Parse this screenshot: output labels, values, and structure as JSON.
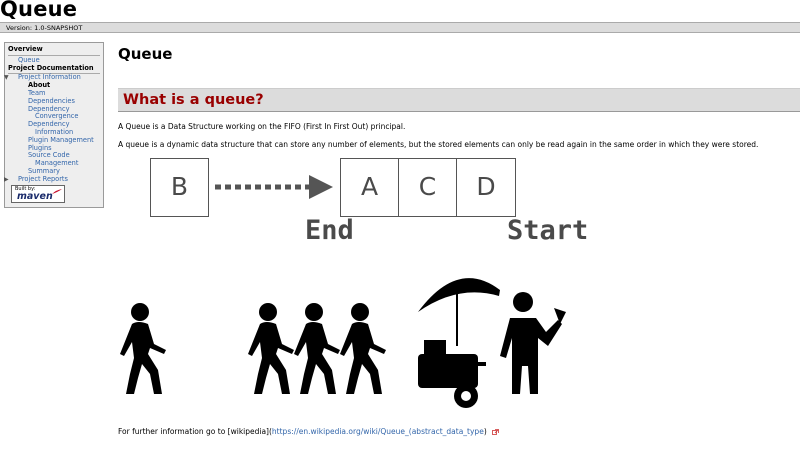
{
  "banner": {
    "title": "Queue"
  },
  "breadcrumbs": {
    "version": "Version: 1.0-SNAPSHOT"
  },
  "sidebar": {
    "overview_header": "Overview",
    "overview_items": [
      "Queue"
    ],
    "project_doc_header": "Project Documentation",
    "project_information": "Project Information",
    "project_info_items": {
      "about": "About",
      "team": "Team",
      "dependencies": "Dependencies",
      "dependency_convergence_1": "Dependency",
      "dependency_convergence_2": "Convergence",
      "dependency_information_1": "Dependency",
      "dependency_information_2": "Information",
      "plugin_management": "Plugin Management",
      "plugins": "Plugins",
      "source_code_1": "Source Code",
      "source_code_2": "Management",
      "summary": "Summary"
    },
    "project_reports": "Project Reports",
    "built_by": {
      "label": "Built by:",
      "brand": "maven"
    }
  },
  "content": {
    "page_title": "Queue",
    "section_title": "What is a queue?",
    "paragraph1": "A Queue is a Data Structure working on the FIFO (First In First Out) principal.",
    "paragraph2": "A queue is a dynamic data structure that can store any number of elements, but the stored elements can only be read again in the same order in which they were stored.",
    "further_prefix": "For further information go to [wikipedia](",
    "further_link": "https://en.wikipedia.org/wiki/Queue_(abstract_data_type",
    "further_suffix": ")"
  },
  "diagram": {
    "incoming": "B",
    "queue": [
      "A",
      "C",
      "D"
    ],
    "end_label": "End",
    "start_label": "Start",
    "ink_color": "#4a4a4a"
  },
  "colors": {
    "section_title": "#990000",
    "link": "#3366aa",
    "section_bg": "#dcdcdc"
  }
}
